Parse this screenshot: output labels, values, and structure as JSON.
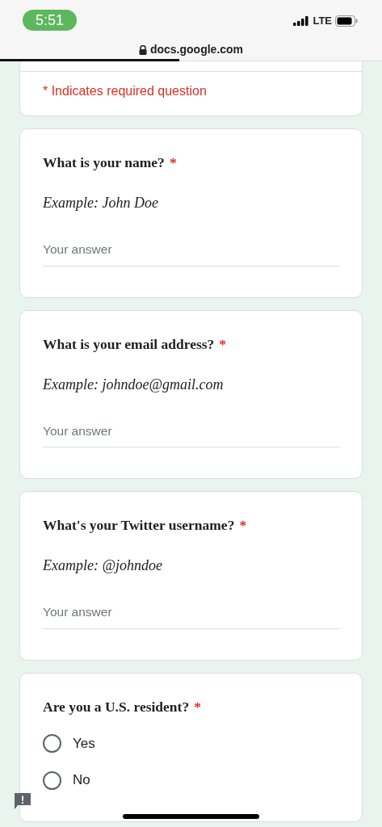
{
  "status_bar": {
    "time": "5:51",
    "network": "LTE"
  },
  "address_bar": {
    "domain": "docs.google.com",
    "level": 0.47
  },
  "form": {
    "required_note": "* Indicates required question",
    "questions": [
      {
        "kind": "text",
        "title": "What is your name?",
        "required": true,
        "required_mark": "*",
        "description": "Example: John Doe",
        "placeholder": "Your answer"
      },
      {
        "kind": "text",
        "title": "What is your email address?",
        "required": true,
        "required_mark": "*",
        "description": "Example: johndoe@gmail.com",
        "placeholder": "Your answer"
      },
      {
        "kind": "text",
        "title": "What's your Twitter username?",
        "required": true,
        "required_mark": "*",
        "description": "Example: @johndoe",
        "placeholder": "Your answer"
      },
      {
        "kind": "choice",
        "title": "Are you a U.S. resident?",
        "required": true,
        "required_mark": "*",
        "options": [
          {
            "label": "Yes",
            "selected": false
          },
          {
            "label": "No",
            "selected": false
          }
        ]
      }
    ]
  }
}
